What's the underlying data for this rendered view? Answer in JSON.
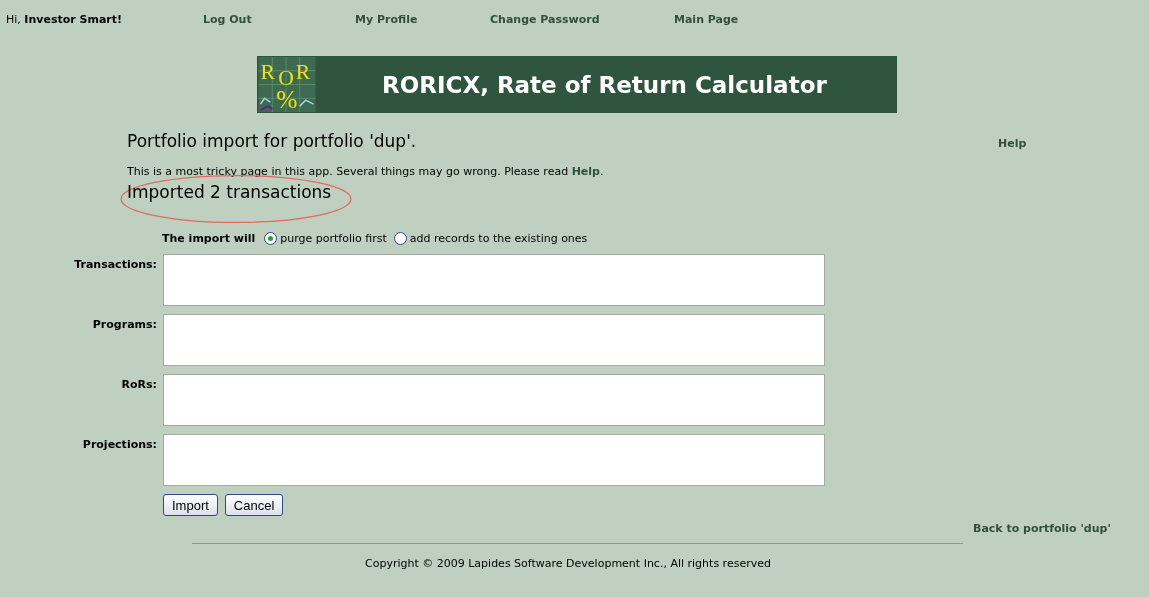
{
  "top_nav": {
    "greeting": "Hi,",
    "user": "Investor Smart!",
    "links": [
      "Log Out",
      "My Profile",
      "Change Password",
      "Main Page"
    ]
  },
  "banner": {
    "logo_letters": [
      "R",
      "O",
      "R"
    ],
    "logo_symbol": "%",
    "title": "RORICX, Rate of Return Calculator"
  },
  "heading": "Portfolio import for portfolio 'dup'.",
  "help_link": "Help",
  "notice": {
    "text": "This is a most tricky page in this app. Several things may go wrong. Please read ",
    "link": "Help",
    "end": "."
  },
  "result": {
    "text": "Imported 2 transactions",
    "circled": true
  },
  "import_mode": {
    "label": "The import will",
    "options": [
      {
        "label": "purge portfolio first",
        "selected": true
      },
      {
        "label": "add records to the existing ones",
        "selected": false
      }
    ]
  },
  "fields": [
    {
      "label": "Transactions:"
    },
    {
      "label": "Programs:"
    },
    {
      "label": "RoRs:"
    },
    {
      "label": "Projections:"
    }
  ],
  "buttons": [
    "Import",
    "Cancel"
  ],
  "back_link": "Back to portfolio 'dup'",
  "footer": "Copyright © 2009 Lapides Software Development Inc., All rights reserved"
}
